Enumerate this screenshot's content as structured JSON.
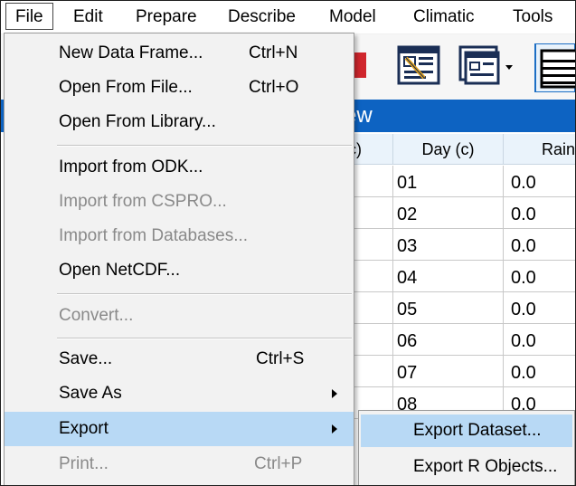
{
  "menubar": {
    "items": [
      {
        "label": "File"
      },
      {
        "label": "Edit"
      },
      {
        "label": "Prepare"
      },
      {
        "label": "Describe"
      },
      {
        "label": "Model"
      },
      {
        "label": "Climatic"
      },
      {
        "label": "Tools"
      }
    ]
  },
  "view": {
    "title": "ew"
  },
  "grid": {
    "headers": [
      "c)",
      "Day (c)",
      "Rain"
    ],
    "day_values": [
      "01",
      "02",
      "03",
      "04",
      "05",
      "06",
      "07",
      "08"
    ],
    "rain_values": [
      "0.0",
      "0.0",
      "0.0",
      "0.0",
      "0.0",
      "0.0",
      "0.0",
      "0.0"
    ]
  },
  "file_menu": {
    "new_data_frame": {
      "label": "New Data Frame...",
      "shortcut": "Ctrl+N"
    },
    "open_from_file": {
      "label": "Open From File...",
      "shortcut": "Ctrl+O"
    },
    "open_from_library": {
      "label": "Open From Library..."
    },
    "import_from_odk": {
      "label": "Import from ODK..."
    },
    "import_from_cspro": {
      "label": "Import from CSPRO..."
    },
    "import_from_databases": {
      "label": "Import from Databases..."
    },
    "open_netcdf": {
      "label": "Open NetCDF..."
    },
    "convert": {
      "label": "Convert..."
    },
    "save": {
      "label": "Save...",
      "shortcut": "Ctrl+S"
    },
    "save_as": {
      "label": "Save As"
    },
    "export": {
      "label": "Export"
    },
    "print": {
      "label": "Print...",
      "shortcut": "Ctrl+P"
    }
  },
  "export_submenu": {
    "export_dataset": {
      "label": "Export Dataset..."
    },
    "export_r_objects": {
      "label": "Export R Objects..."
    }
  },
  "colors": {
    "highlight": "#b8d9f5",
    "title_bar": "#0d63c2",
    "menu_bg": "#f2f2f2",
    "disabled_text": "#8a8a8a"
  }
}
